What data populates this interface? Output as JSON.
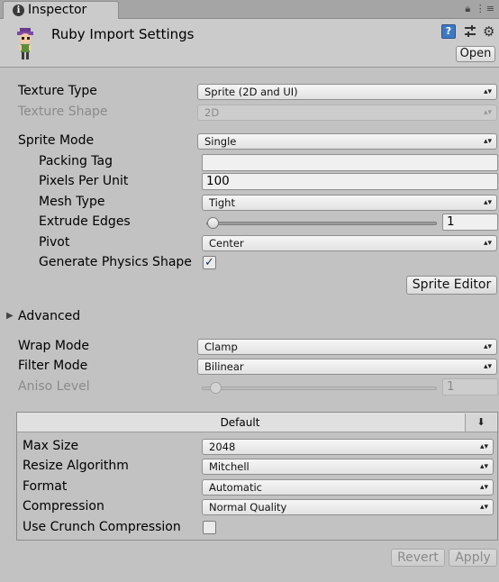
{
  "tab": {
    "title": "Inspector",
    "icon": "info-icon"
  },
  "header": {
    "title": "Ruby Import Settings",
    "open_label": "Open"
  },
  "texture": {
    "type_label": "Texture Type",
    "type_value": "Sprite (2D and UI)",
    "shape_label": "Texture Shape",
    "shape_value": "2D"
  },
  "sprite": {
    "mode_label": "Sprite Mode",
    "mode_value": "Single",
    "packing_tag_label": "Packing Tag",
    "packing_tag_value": "",
    "ppu_label": "Pixels Per Unit",
    "ppu_value": "100",
    "mesh_type_label": "Mesh Type",
    "mesh_type_value": "Tight",
    "extrude_label": "Extrude Edges",
    "extrude_value": "1",
    "pivot_label": "Pivot",
    "pivot_value": "Center",
    "physics_label": "Generate Physics Shape",
    "physics_checked": true,
    "editor_button": "Sprite Editor"
  },
  "advanced": {
    "label": "Advanced"
  },
  "sampling": {
    "wrap_label": "Wrap Mode",
    "wrap_value": "Clamp",
    "filter_label": "Filter Mode",
    "filter_value": "Bilinear",
    "aniso_label": "Aniso Level",
    "aniso_value": "1"
  },
  "platform": {
    "tab_label": "Default",
    "max_size_label": "Max Size",
    "max_size_value": "2048",
    "resize_label": "Resize Algorithm",
    "resize_value": "Mitchell",
    "format_label": "Format",
    "format_value": "Automatic",
    "compression_label": "Compression",
    "compression_value": "Normal Quality",
    "crunch_label": "Use Crunch Compression",
    "crunch_checked": false
  },
  "footer": {
    "revert": "Revert",
    "apply": "Apply"
  },
  "colors": {
    "panel_bg": "#c2c2c2",
    "checkbox_check": "#1b2f58",
    "help_icon": "#3f78c2"
  }
}
